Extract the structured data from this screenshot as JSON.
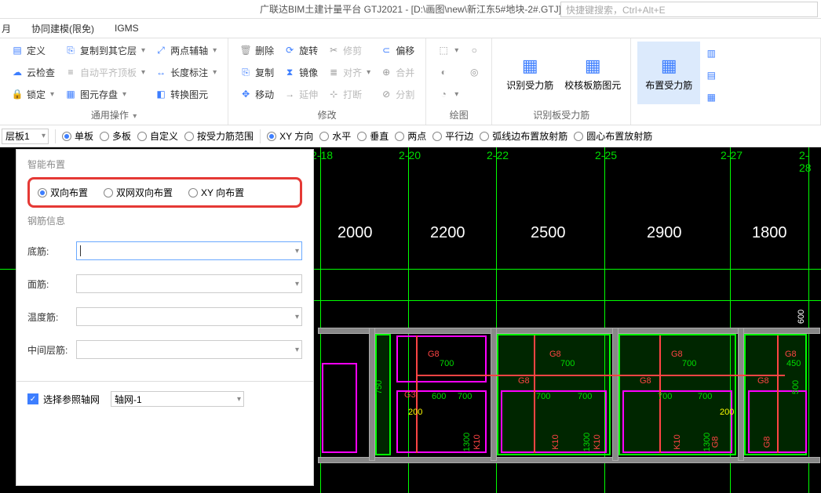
{
  "title": "广联达BIM土建计量平台 GTJ2021 - [D:\\画图\\new\\新江东5#地块-2#.GTJ]",
  "search_placeholder": "快捷键搜索，Ctrl+Alt+E",
  "menu": {
    "m1": "协同建模(限免)",
    "m2": "IGMS"
  },
  "ribbon": {
    "g1": {
      "b1": "定义",
      "b2": "云检查",
      "b3": "锁定",
      "b4": "复制到其它层",
      "b5": "自动平齐顶板",
      "b6": "图元存盘",
      "b7": "两点辅轴",
      "b8": "长度标注",
      "b9": "转换图元",
      "label": "通用操作"
    },
    "g2": {
      "b1": "删除",
      "b2": "复制",
      "b3": "移动",
      "b4": "旋转",
      "b5": "镜像",
      "b6": "延伸",
      "b7": "修剪",
      "b8": "对齐",
      "b9": "打断",
      "b10": "偏移",
      "b11": "合并",
      "b12": "分割",
      "label": "修改"
    },
    "g3": {
      "label": "绘图"
    },
    "g4": {
      "b1": "识别受力筋",
      "b2": "校核板筋图元",
      "label": "识别板受力筋"
    },
    "g5": {
      "b1": "布置受力筋"
    }
  },
  "optbar": {
    "layer": "层板1",
    "r1": "单板",
    "r2": "多板",
    "r3": "自定义",
    "r4": "按受力筋范围",
    "r5": "XY 方向",
    "r6": "水平",
    "r7": "垂直",
    "r8": "两点",
    "r9": "平行边",
    "r10": "弧线边布置放射筋",
    "r11": "圆心布置放射筋"
  },
  "panel": {
    "sec1": "智能布置",
    "r1": "双向布置",
    "r2": "双网双向布置",
    "r3": "XY 向布置",
    "sec2": "钢筋信息",
    "f1": "底筋:",
    "f2": "面筋:",
    "f3": "温度筋:",
    "f4": "中间层筋:",
    "chk": "选择参照轴网",
    "grid": "轴网-1"
  },
  "axes": {
    "a1": "2-18",
    "a2": "2-20",
    "a3": "2-22",
    "a4": "2-25",
    "a5": "2-27",
    "a6": "2-28"
  },
  "dims": {
    "d1": "2000",
    "d2": "2200",
    "d3": "2500",
    "d4": "2900",
    "d5": "1800",
    "d6": "600"
  },
  "annot": {
    "g8": "G8",
    "k10": "K10",
    "v200": "200",
    "v700": "700",
    "v750": "750",
    "v1300": "1300",
    "v600": "600",
    "v450": "450",
    "v500": "500",
    "g3": "G3"
  }
}
